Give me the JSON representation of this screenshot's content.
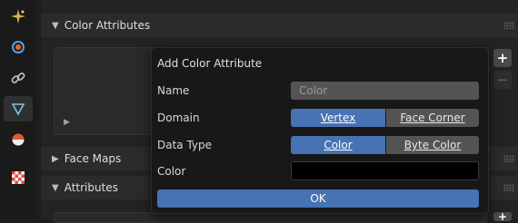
{
  "tabs": [
    {
      "icon": "sparkle-icon",
      "color": "#d7b84a"
    },
    {
      "icon": "physics-icon",
      "color": "#e06a2a"
    },
    {
      "icon": "constraint-icon",
      "color": "#c8c8c8"
    },
    {
      "icon": "mesh-data-icon",
      "color": "#7fc0e8"
    },
    {
      "icon": "material-icon",
      "color": "#e05a3a"
    },
    {
      "icon": "texture-icon",
      "color": "#e04a4a"
    }
  ],
  "sections": {
    "color_attributes": "Color Attributes",
    "face_maps": "Face Maps",
    "attributes": "Attributes"
  },
  "side_buttons": {
    "add": "+",
    "remove": "−"
  },
  "dialog": {
    "title": "Add Color Attribute",
    "name_label": "Name",
    "name_value": "Color",
    "domain_label": "Domain",
    "domain_options": [
      "Vertex",
      "Face Corner"
    ],
    "domain_selected": "Vertex",
    "data_type_label": "Data Type",
    "data_type_options": [
      "Color",
      "Byte Color"
    ],
    "data_type_selected": "Color",
    "color_label": "Color",
    "color_value": "#000000",
    "ok_label": "OK"
  },
  "accent": "#4772b3"
}
